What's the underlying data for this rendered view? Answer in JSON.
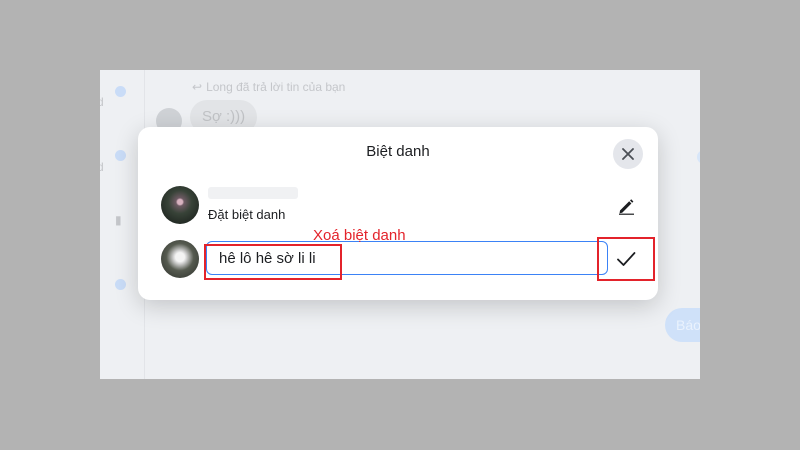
{
  "background_chat": {
    "reply_note": "Long đã trả lời tin của bạn",
    "reply_icon": "reply-arrow-icon",
    "message_bubble": "Sợ :)))",
    "outgoing_pill": "Báo"
  },
  "dialog": {
    "title": "Biệt danh",
    "close_icon": "close-icon",
    "participant_1": {
      "name_blurred": true,
      "subtitle": "Đặt biệt danh",
      "action_icon": "pencil-icon"
    },
    "participant_2": {
      "nickname_value": "hê lô hê sờ li li",
      "action_icon": "checkmark-icon"
    }
  },
  "annotation": {
    "label": "Xoá biệt danh",
    "color": "#e3232b"
  },
  "colors": {
    "input_focus": "#3b82f6",
    "dim_overlay": "#b3b3b3"
  }
}
